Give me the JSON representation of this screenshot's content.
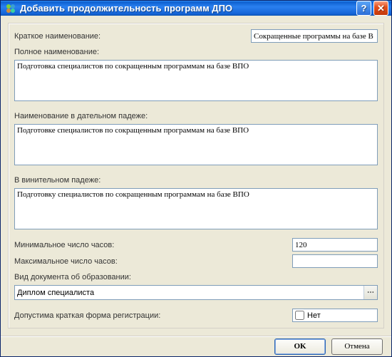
{
  "window": {
    "title": "Добавить продолжительность программ ДПО"
  },
  "labels": {
    "shortName": "Краткое наименование:",
    "fullName": "Полное наименование:",
    "dative": "Наименование в дательном падеже:",
    "accusative": "В винительном падеже:",
    "minHours": "Минимальное число часов:",
    "maxHours": "Максимальное число часов:",
    "docType": "Вид документа об образовании:",
    "shortRegistration": "Допустима краткая форма регистрации:"
  },
  "values": {
    "shortName": "Сокращенные программы на базе В",
    "fullName": "Подготовка специалистов по сокращенным программам на базе ВПО",
    "dative": "Подготовке специалистов по сокращенным программам на базе ВПО",
    "accusative": "Подготовку специалистов по сокращенным программам на базе ВПО",
    "minHours": "120",
    "maxHours": "",
    "docType": "Диплом специалиста",
    "shortRegistrationChecked": false,
    "shortRegistrationText": "Нет"
  },
  "buttons": {
    "ok": "OK",
    "cancel": "Отмена"
  },
  "colors": {
    "titlebar": "#1463d6",
    "border": "#7f9db9",
    "panel": "#ece9d8"
  }
}
